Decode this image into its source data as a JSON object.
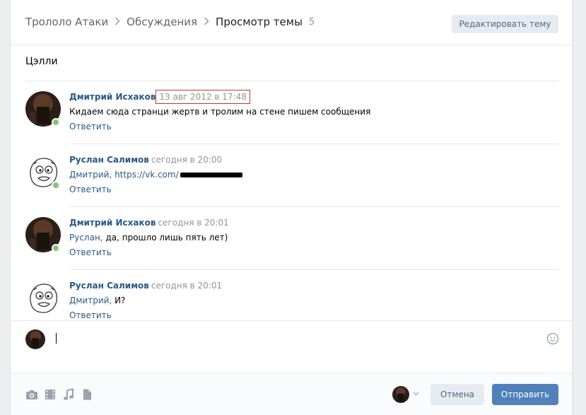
{
  "breadcrumb": {
    "items": [
      "Трололо Атаки",
      "Обсуждения",
      "Просмотр темы"
    ],
    "count": "5"
  },
  "header": {
    "edit_button": "Редактировать тему"
  },
  "topic": {
    "title": "Цэлли"
  },
  "comments": [
    {
      "author": "Дмитрий Исхаков",
      "date": "13 авг 2012 в 17:48",
      "text": "Кидаем сюда странци жертв и тролим на стене пишем сообщения",
      "reply_label": "Ответить"
    },
    {
      "author": "Руслан Салимов",
      "date": "сегодня в 20:00",
      "reply_to": "Дмитрий,",
      "link": "https://vk.com/",
      "reply_label": "Ответить"
    },
    {
      "author": "Дмитрий Исхаков",
      "date": "сегодня в 20:01",
      "reply_to": "Руслан,",
      "text": "да, прошло лишь пять лет)",
      "reply_label": "Ответить"
    },
    {
      "author": "Руслан Салимов",
      "date": "сегодня в 20:01",
      "reply_to": "Дмитрий,",
      "text": "И?",
      "reply_label": "Ответить"
    }
  ],
  "composer": {
    "cancel_label": "Отмена",
    "send_label": "Отправить",
    "attach_icons": [
      "camera-icon",
      "video-icon",
      "music-icon",
      "document-icon"
    ]
  },
  "colors": {
    "link": "#2a5885",
    "send_button": "#5181b8",
    "online": "#8ac176"
  }
}
